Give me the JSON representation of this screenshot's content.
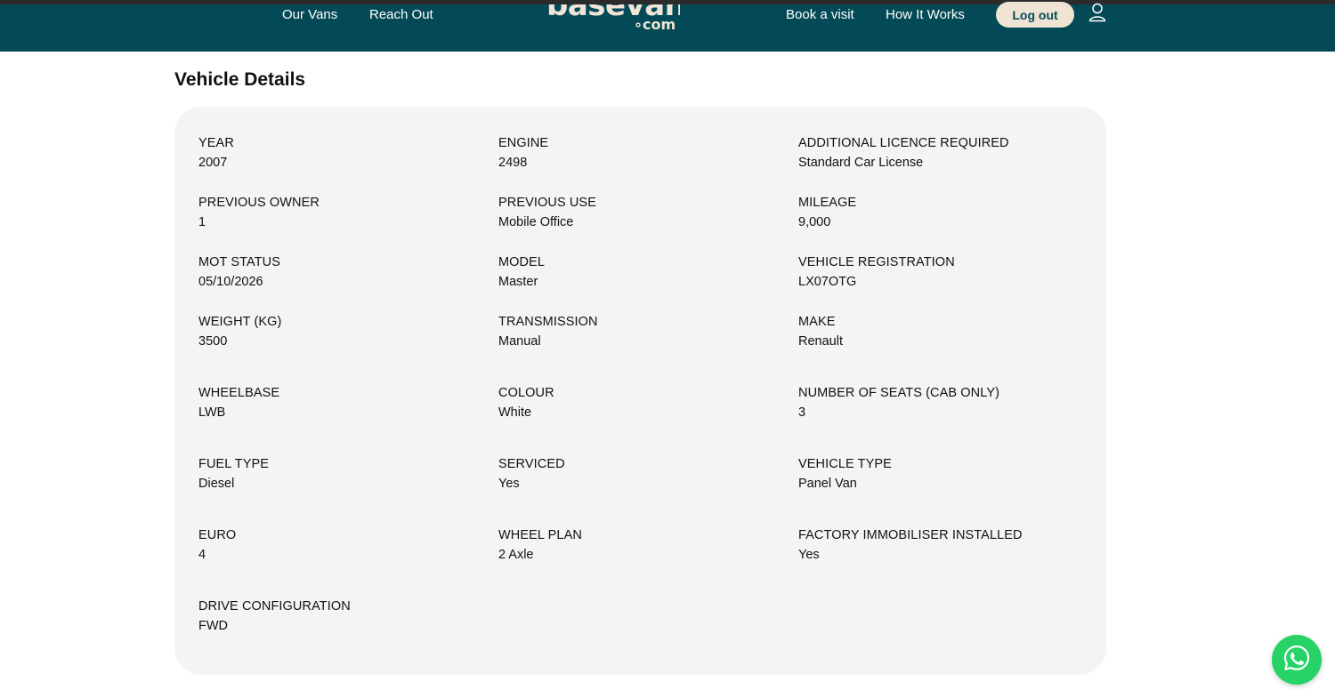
{
  "header": {
    "nav_left": [
      "Our Vans",
      "Reach Out"
    ],
    "logo_text": "basevan",
    "logo_suffix": "∘com",
    "nav_right": [
      "Book a visit",
      "How It Works"
    ],
    "logout_label": "Log out",
    "icons": {
      "user": "user-icon"
    },
    "colors": {
      "header_bg": "#034a56",
      "logo": "#f1e6d6",
      "logout_bg": "#efe3d3"
    }
  },
  "page": {
    "title": "Vehicle Details"
  },
  "details": {
    "items": [
      {
        "label": "YEAR",
        "value": "2007"
      },
      {
        "label": "ENGINE",
        "value": "2498"
      },
      {
        "label": "ADDITIONAL LICENCE REQUIRED",
        "value": "Standard Car License"
      },
      {
        "label": "PREVIOUS OWNER",
        "value": "1"
      },
      {
        "label": "PREVIOUS USE",
        "value": "Mobile Office"
      },
      {
        "label": "MILEAGE",
        "value": "9,000"
      },
      {
        "label": "MOT STATUS",
        "value": "05/10/2026"
      },
      {
        "label": "MODEL",
        "value": "Master"
      },
      {
        "label": "VEHICLE REGISTRATION",
        "value": "LX07OTG"
      },
      {
        "label": "WEIGHT (KG)",
        "value": "3500"
      },
      {
        "label": "TRANSMISSION",
        "value": "Manual"
      },
      {
        "label": "MAKE",
        "value": "Renault"
      },
      {
        "label": "WHEELBASE",
        "value": "LWB"
      },
      {
        "label": "COLOUR",
        "value": "White"
      },
      {
        "label": "NUMBER OF SEATS (CAB ONLY)",
        "value": "3"
      },
      {
        "label": "FUEL TYPE",
        "value": "Diesel"
      },
      {
        "label": "SERVICED",
        "value": "Yes"
      },
      {
        "label": "VEHICLE TYPE",
        "value": "Panel Van"
      },
      {
        "label": "EURO",
        "value": "4"
      },
      {
        "label": "WHEEL PLAN",
        "value": "2 Axle"
      },
      {
        "label": "FACTORY IMMOBILISER INSTALLED",
        "value": "Yes"
      },
      {
        "label": "DRIVE CONFIGURATION",
        "value": "FWD"
      }
    ]
  },
  "floating": {
    "whatsapp_icon": "whatsapp-icon",
    "color": "#25d366"
  }
}
